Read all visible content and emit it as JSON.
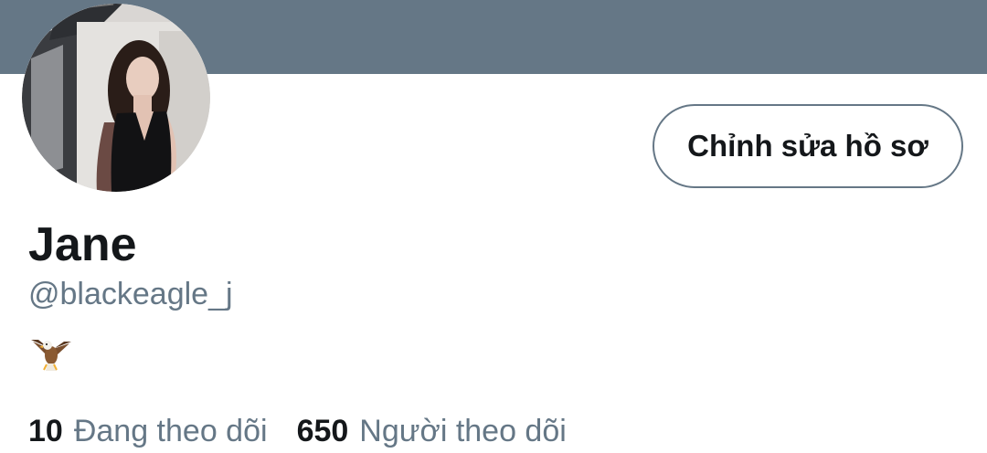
{
  "profile": {
    "banner_color": "#657786",
    "avatar": "profile-photo",
    "display_name": "Jane",
    "handle": "@blackeagle_j",
    "bio_icon": "eagle-emoji"
  },
  "actions": {
    "edit_profile_label": "Chỉnh sửa hồ sơ"
  },
  "stats": {
    "following_count": "10",
    "following_label": "Đang theo dõi",
    "followers_count": "650",
    "followers_label": "Người theo dõi"
  },
  "colors": {
    "text_primary": "#14171a",
    "text_secondary": "#657786",
    "button_border": "#657786"
  }
}
